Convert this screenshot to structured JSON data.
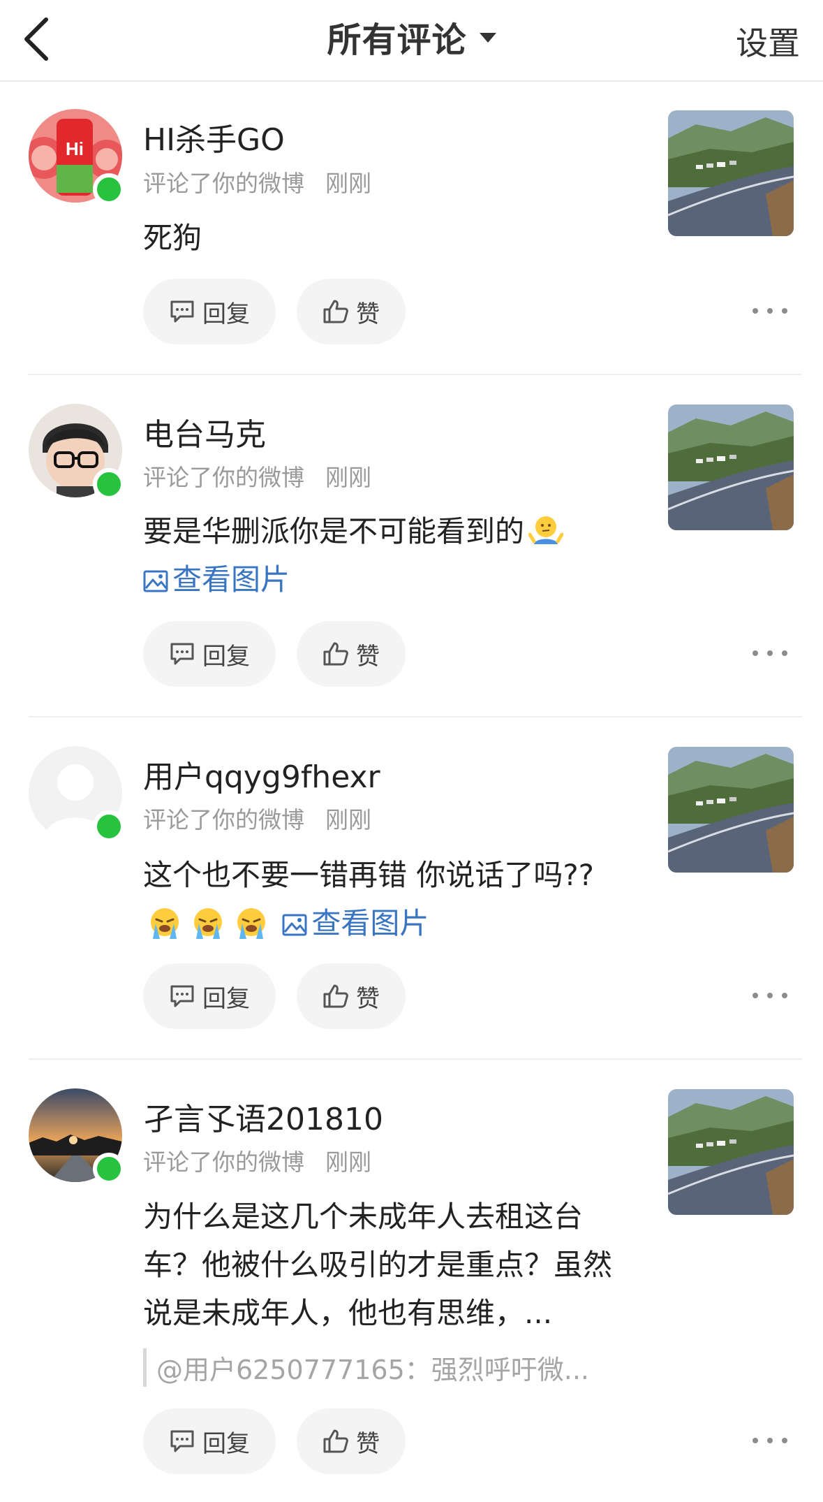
{
  "header": {
    "title": "所有评论",
    "settings_label": "设置"
  },
  "comments": [
    {
      "username": "HI杀手GO",
      "action": "评论了你的微博",
      "time": "刚刚",
      "text": "死狗",
      "reply_label": "回复",
      "like_label": "赞"
    },
    {
      "username": "电台马克",
      "action": "评论了你的微博",
      "time": "刚刚",
      "text": "要是华删派你是不可能看到的",
      "emoji": "shrug-emoji",
      "view_image_label": "查看图片",
      "reply_label": "回复",
      "like_label": "赞"
    },
    {
      "username": "用户qqyg9fhexr",
      "action": "评论了你的微博",
      "time": "刚刚",
      "text": "这个也不要一错再错  你说话了吗??",
      "emoji": "crying-emoji",
      "view_image_label": "查看图片",
      "reply_label": "回复",
      "like_label": "赞"
    },
    {
      "username": "孑言孓语201810",
      "action": "评论了你的微博",
      "time": "刚刚",
      "text": "为什么是这几个未成年人去租这台车？他被什么吸引的才是重点？虽然说是未成年人，他也有思维，...",
      "quote": "@用户6250777165：强烈呼吁微...",
      "reply_label": "回复",
      "like_label": "赞"
    }
  ],
  "colors": {
    "link": "#3a75c4",
    "online": "#27c33f",
    "meta": "#9a9a9a"
  }
}
